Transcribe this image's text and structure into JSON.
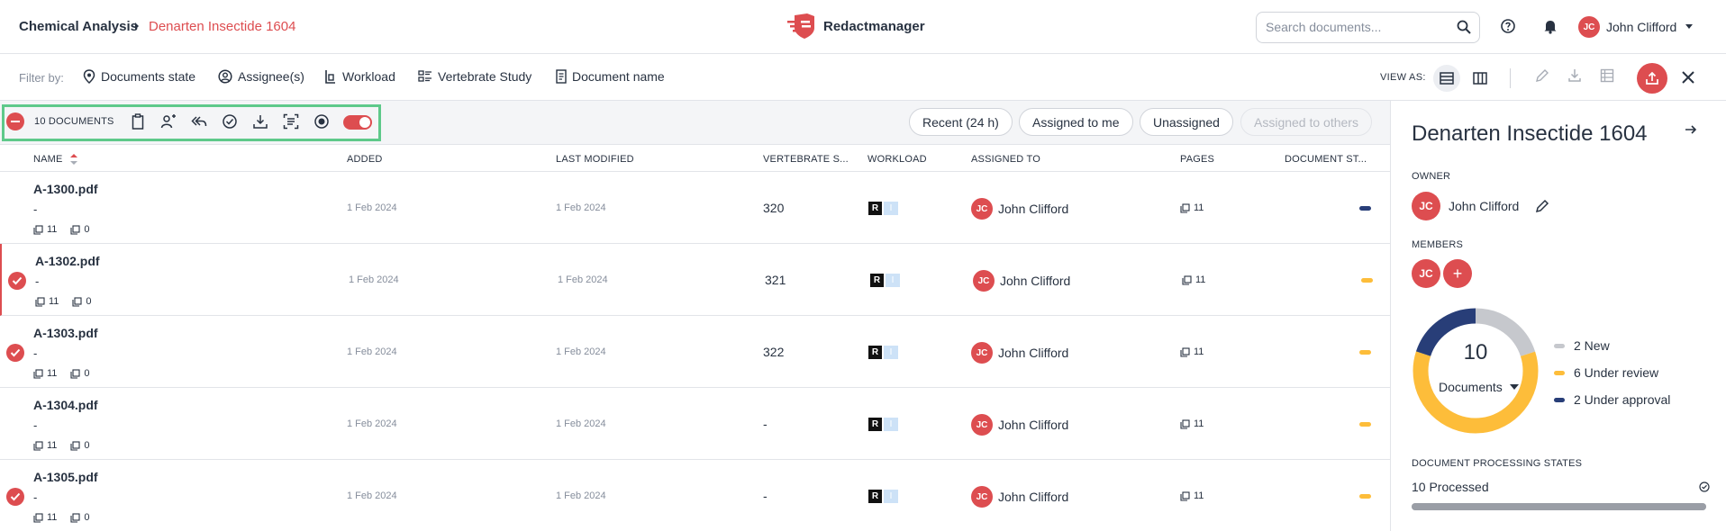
{
  "header": {
    "breadcrumb_root": "Chemical Analysis",
    "breadcrumb_current": "Denarten Insectide 1604",
    "app_name": "Redactmanager",
    "search_placeholder": "Search documents...",
    "user_initials": "JC",
    "user_name": "John Clifford"
  },
  "filters": {
    "label": "Filter by:",
    "items": [
      "Documents state",
      "Assignee(s)",
      "Workload",
      "Vertebrate Study",
      "Document name"
    ],
    "view_as_label": "VIEW AS:"
  },
  "actions": {
    "doc_count": "10 DOCUMENTS",
    "quick_filters": [
      "Recent (24 h)",
      "Assigned to me",
      "Unassigned",
      "Assigned to others"
    ]
  },
  "table": {
    "columns": [
      "NAME",
      "ADDED",
      "LAST MODIFIED",
      "VERTEBRATE S...",
      "WORKLOAD",
      "ASSIGNED TO",
      "PAGES",
      "DOCUMENT ST..."
    ],
    "rows": [
      {
        "name": "A-1300.pdf",
        "sub": "-",
        "pages_meta": "11",
        "comments_meta": "0",
        "added": "1 Feb 2024",
        "modified": "1 Feb 2024",
        "vertebrate": "320",
        "workload_r": "R",
        "workload_i": "I",
        "assignee_initials": "JC",
        "assignee": "John Clifford",
        "pages": "11",
        "selected": false,
        "status_color": "#283e78"
      },
      {
        "name": "A-1302.pdf",
        "sub": "-",
        "pages_meta": "11",
        "comments_meta": "0",
        "added": "1 Feb 2024",
        "modified": "1 Feb 2024",
        "vertebrate": "321",
        "workload_r": "R",
        "workload_i": "I",
        "assignee_initials": "JC",
        "assignee": "John Clifford",
        "pages": "11",
        "selected": true,
        "status_color": "#fdbd3a"
      },
      {
        "name": "A-1303.pdf",
        "sub": "-",
        "pages_meta": "11",
        "comments_meta": "0",
        "added": "1 Feb 2024",
        "modified": "1 Feb 2024",
        "vertebrate": "322",
        "workload_r": "R",
        "workload_i": "I",
        "assignee_initials": "JC",
        "assignee": "John Clifford",
        "pages": "11",
        "selected": true,
        "status_color": "#fdbd3a"
      },
      {
        "name": "A-1304.pdf",
        "sub": "-",
        "pages_meta": "11",
        "comments_meta": "0",
        "added": "1 Feb 2024",
        "modified": "1 Feb 2024",
        "vertebrate": "-",
        "workload_r": "R",
        "workload_i": "I",
        "assignee_initials": "JC",
        "assignee": "John Clifford",
        "pages": "11",
        "selected": false,
        "status_color": "#fdbd3a"
      },
      {
        "name": "A-1305.pdf",
        "sub": "-",
        "pages_meta": "11",
        "comments_meta": "0",
        "added": "1 Feb 2024",
        "modified": "1 Feb 2024",
        "vertebrate": "-",
        "workload_r": "R",
        "workload_i": "I",
        "assignee_initials": "JC",
        "assignee": "John Clifford",
        "pages": "11",
        "selected": true,
        "status_color": "#fdbd3a"
      }
    ]
  },
  "panel": {
    "title": "Denarten Insectide 1604",
    "owner_label": "OWNER",
    "owner_initials": "JC",
    "owner_name": "John Clifford",
    "members_label": "MEMBERS",
    "member_initials": "JC",
    "add_member": "+",
    "donut_total": "10",
    "donut_sub": "Documents",
    "legend": [
      {
        "label": "2 New",
        "color": "#c6c8cd",
        "value": 2
      },
      {
        "label": "6 Under review",
        "color": "#fdbd3a",
        "value": 6
      },
      {
        "label": "2 Under approval",
        "color": "#283e78",
        "value": 2
      }
    ],
    "processing_label": "DOCUMENT PROCESSING STATES",
    "processed": "10 Processed",
    "processed_fraction": 1.0
  },
  "colors": {
    "accent": "#dd4d50",
    "selection_outline": "#5ec98a"
  }
}
